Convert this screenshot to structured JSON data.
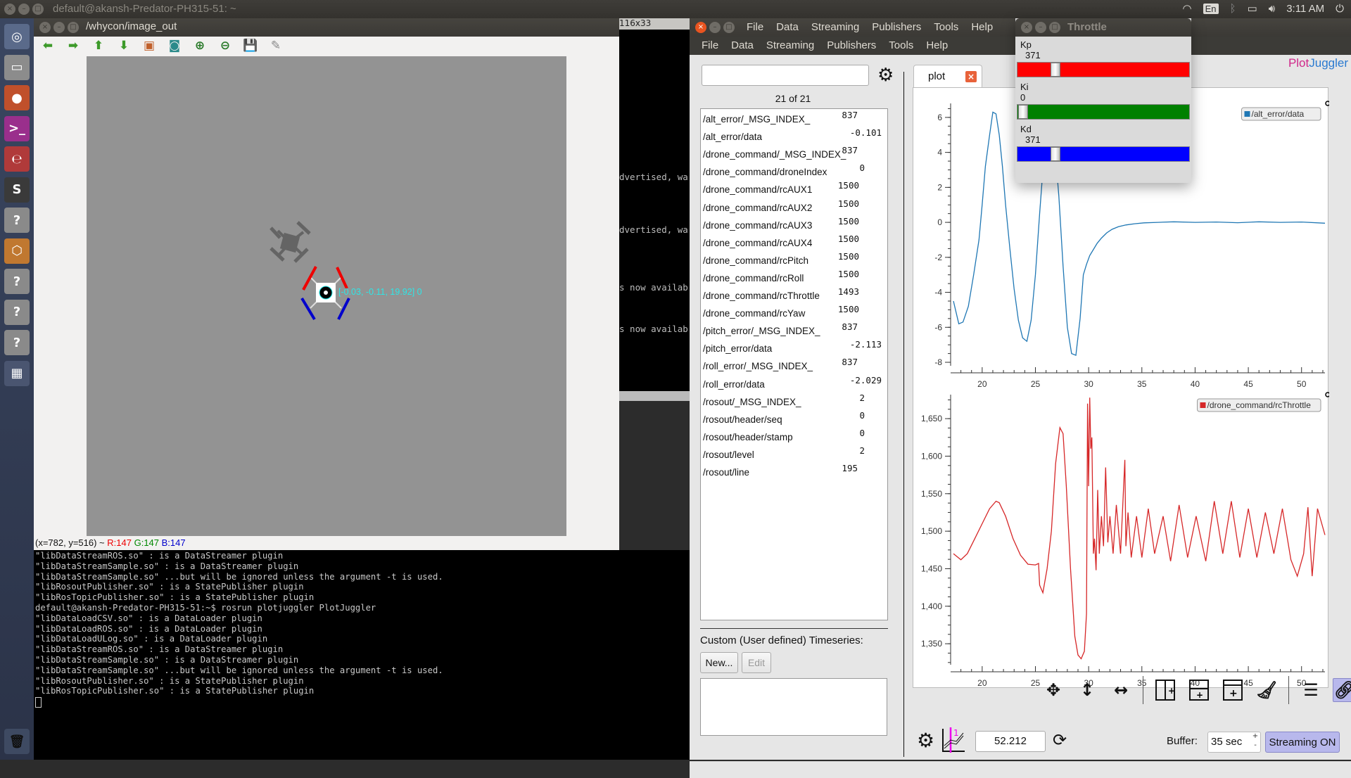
{
  "top_panel": {
    "window_title": "default@akansh-Predator-PH315-51: ~",
    "keyboard_layout": "En",
    "clock": "3:11 AM",
    "icons": [
      "wifi-icon",
      "keyboard-icon",
      "bluetooth-icon",
      "battery-icon",
      "volume-icon",
      "power-icon"
    ]
  },
  "launcher": {
    "items": [
      {
        "name": "ubuntu-dash",
        "glyph": "◎",
        "color": "#5a6a8a"
      },
      {
        "name": "files",
        "glyph": "▭",
        "color": "#8c8c8c"
      },
      {
        "name": "firefox",
        "glyph": "●",
        "color": "#c0502b"
      },
      {
        "name": "terminal",
        "glyph": ">_",
        "color": "#9a2f8c"
      },
      {
        "name": "document-viewer",
        "glyph": "℮",
        "color": "#b03a3a"
      },
      {
        "name": "sublime-text",
        "glyph": "S",
        "color": "#3a3a3a"
      },
      {
        "name": "unknown-app",
        "glyph": "?",
        "color": "#8a8a8a"
      },
      {
        "name": "virtualbox",
        "glyph": "⬡",
        "color": "#c07830"
      },
      {
        "name": "unknown-app",
        "glyph": "?",
        "color": "#8a8a8a"
      },
      {
        "name": "unknown-app",
        "glyph": "?",
        "color": "#8a8a8a"
      },
      {
        "name": "unknown-app",
        "glyph": "?",
        "color": "#8a8a8a"
      },
      {
        "name": "workspace-switcher",
        "glyph": "▦",
        "color": "#4a5570"
      }
    ],
    "trash_glyph": "🗑"
  },
  "image_viewer": {
    "title": "/whycon/image_out",
    "toolbar": [
      {
        "name": "back",
        "glyph": "⬅",
        "color": "#3d9a2a"
      },
      {
        "name": "forward",
        "glyph": "➡",
        "color": "#3d9a2a"
      },
      {
        "name": "up",
        "glyph": "⬆",
        "color": "#3d9a2a"
      },
      {
        "name": "down",
        "glyph": "⬇",
        "color": "#3d9a2a"
      },
      {
        "name": "fit-image",
        "glyph": "▣",
        "color": "#c0602b"
      },
      {
        "name": "zoom-original",
        "glyph": "◙",
        "color": "#2a8a8a"
      },
      {
        "name": "zoom-in",
        "glyph": "⊕",
        "color": "#2a7a2a"
      },
      {
        "name": "zoom-out",
        "glyph": "⊖",
        "color": "#2a7a2a"
      },
      {
        "name": "save",
        "glyph": "💾",
        "color": "#3d9a2a"
      },
      {
        "name": "clear",
        "glyph": "✎",
        "color": "#888888"
      }
    ],
    "overlay_text": "[-0.03, -0.11, 19.92] 0",
    "status": {
      "coords": "(x=782, y=516) ~ ",
      "r": "R:147",
      "g": "G:147",
      "b": "B:147"
    }
  },
  "terminal_main": {
    "lines": [
      "\"libDataStreamROS.so\" : is a DataStreamer plugin",
      "\"libDataStreamSample.so\" : is a DataStreamer plugin",
      "\"libDataStreamSample.so\" ...but will be ignored unless the argument -t is used.",
      "\"libRosoutPublisher.so\" : is a StatePublisher plugin",
      "\"libRosTopicPublisher.so\" : is a StatePublisher plugin",
      "default@akansh-Predator-PH315-51:~$ rosrun plotjuggler PlotJuggler",
      "\"libDataLoadCSV.so\" : is a DataLoader plugin",
      "\"libDataLoadROS.so\" : is a DataLoader plugin",
      "\"libDataLoadULog.so\" : is a DataLoader plugin",
      "\"libDataStreamROS.so\" : is a DataStreamer plugin",
      "\"libDataStreamSample.so\" : is a DataStreamer plugin",
      "\"libDataStreamSample.so\" ...but will be ignored unless the argument -t is used.",
      "\"libRosoutPublisher.so\" : is a StatePublisher plugin",
      "\"libRosTopicPublisher.so\" : is a StatePublisher plugin"
    ]
  },
  "terminal_side": {
    "size_label": "116x33",
    "lines": [
      "dvertised, wa",
      "dvertised, wa",
      "s now availab",
      "s now availab"
    ]
  },
  "plotjuggler": {
    "menu_top": [
      "File",
      "Data",
      "Streaming",
      "Publishers",
      "Tools",
      "Help"
    ],
    "menu": [
      "File",
      "Data",
      "Streaming",
      "Publishers",
      "Tools",
      "Help"
    ],
    "brand_a": "Plot",
    "brand_b": "Juggler",
    "search_value": "",
    "count_label": "21 of 21",
    "timeseries": [
      {
        "name": "/alt_error/_MSG_INDEX_",
        "value": "837"
      },
      {
        "name": "/alt_error/data",
        "value": "-0.101"
      },
      {
        "name": "/drone_command/_MSG_INDEX_",
        "value": "837"
      },
      {
        "name": "/drone_command/droneIndex",
        "value": "0"
      },
      {
        "name": "/drone_command/rcAUX1",
        "value": "1500"
      },
      {
        "name": "/drone_command/rcAUX2",
        "value": "1500"
      },
      {
        "name": "/drone_command/rcAUX3",
        "value": "1500"
      },
      {
        "name": "/drone_command/rcAUX4",
        "value": "1500"
      },
      {
        "name": "/drone_command/rcPitch",
        "value": "1500"
      },
      {
        "name": "/drone_command/rcRoll",
        "value": "1500"
      },
      {
        "name": "/drone_command/rcThrottle",
        "value": "1493"
      },
      {
        "name": "/drone_command/rcYaw",
        "value": "1500"
      },
      {
        "name": "/pitch_error/_MSG_INDEX_",
        "value": "837"
      },
      {
        "name": "/pitch_error/data",
        "value": "-2.113"
      },
      {
        "name": "/roll_error/_MSG_INDEX_",
        "value": "837"
      },
      {
        "name": "/roll_error/data",
        "value": "-2.029"
      },
      {
        "name": "/rosout/_MSG_INDEX_",
        "value": "2"
      },
      {
        "name": "/rosout/header/seq",
        "value": "0"
      },
      {
        "name": "/rosout/header/stamp",
        "value": "0"
      },
      {
        "name": "/rosout/level",
        "value": "2"
      },
      {
        "name": "/rosout/line",
        "value": "195"
      }
    ],
    "custom_label": "Custom (User defined) Timeseries:",
    "new_button": "New...",
    "edit_button": "Edit",
    "tab_label": "plot",
    "time_value": "52.212",
    "buffer_label": "Buffer:",
    "buffer_value": "35 sec",
    "streaming_button": "Streaming ON",
    "plot_tools": [
      "move-icon",
      "vertical-zoom-icon",
      "horizontal-zoom-icon",
      "split-vertical-icon",
      "split-horizontal-icon",
      "add-plot-icon",
      "clear-icon",
      "legend-icon",
      "link-icon"
    ]
  },
  "throttle": {
    "title": "Throttle",
    "sliders": [
      {
        "label": "Kp",
        "value": "371",
        "fraction": 0.15,
        "color": "#ff0000"
      },
      {
        "label": "Ki",
        "value": "0",
        "fraction": 0.0,
        "color": "#008000"
      },
      {
        "label": "Kd",
        "value": "371",
        "fraction": 0.15,
        "color": "#0000ff"
      }
    ]
  },
  "chart_data": [
    {
      "type": "line",
      "title": "",
      "legend": "/alt_error/data",
      "legend_position": "top-right",
      "color": "#1f77b4",
      "xlim": [
        17.3,
        52.2
      ],
      "ylim": [
        -8.2,
        6.8
      ],
      "xticks": [
        20,
        25,
        30,
        35,
        40,
        45,
        50
      ],
      "yticks": [
        -8,
        -6,
        -4,
        -2,
        0,
        2,
        4,
        6
      ],
      "x": [
        17.3,
        17.8,
        18.2,
        18.7,
        19.2,
        19.7,
        20.0,
        20.3,
        20.7,
        21.0,
        21.3,
        21.6,
        21.9,
        22.2,
        22.6,
        23.0,
        23.4,
        23.8,
        24.2,
        24.6,
        25.0,
        25.4,
        25.8,
        26.2,
        26.5,
        26.8,
        27.2,
        27.6,
        28.0,
        28.4,
        28.8,
        29.2,
        29.5,
        29.8,
        30.1,
        30.4,
        30.8,
        31.2,
        31.7,
        32.2,
        32.8,
        33.5,
        34.3,
        35.2,
        36.5,
        38.0,
        40.0,
        42.0,
        44.0,
        46.0,
        48.0,
        50.0,
        52.2
      ],
      "y": [
        -4.5,
        -5.8,
        -5.7,
        -4.8,
        -3.0,
        -1.0,
        1.0,
        3.2,
        5.0,
        6.3,
        6.2,
        5.0,
        3.2,
        1.0,
        -1.5,
        -3.8,
        -5.6,
        -6.6,
        -6.8,
        -5.6,
        -3.0,
        0.5,
        3.8,
        5.5,
        5.8,
        4.5,
        1.5,
        -2.5,
        -6.0,
        -7.5,
        -7.6,
        -5.5,
        -3.0,
        -2.4,
        -1.9,
        -1.6,
        -1.2,
        -0.9,
        -0.6,
        -0.4,
        -0.25,
        -0.15,
        -0.08,
        -0.03,
        0.0,
        0.03,
        0.0,
        0.02,
        -0.02,
        0.03,
        0.0,
        0.02,
        -0.05
      ]
    },
    {
      "type": "line",
      "title": "",
      "legend": "/drone_command/rcThrottle",
      "legend_position": "top-right",
      "color": "#d62728",
      "xlim": [
        17.3,
        52.2
      ],
      "ylim": [
        1322,
        1682
      ],
      "xticks": [
        20,
        25,
        30,
        35,
        40,
        45,
        50
      ],
      "yticks": [
        1350,
        1400,
        1450,
        1500,
        1550,
        1600,
        1650
      ],
      "ytick_labels": [
        "1,350",
        "1,400",
        "1,450",
        "1,500",
        "1,550",
        "1,600",
        "1,650"
      ],
      "x": [
        17.3,
        18.0,
        18.6,
        19.3,
        20.0,
        20.7,
        21.3,
        21.6,
        22.2,
        22.9,
        23.6,
        24.3,
        25.0,
        25.3,
        25.4,
        25.7,
        26.1,
        26.5,
        26.9,
        27.3,
        27.6,
        27.9,
        28.3,
        28.7,
        29.0,
        29.3,
        29.6,
        29.8,
        29.9,
        30.0,
        30.1,
        30.2,
        30.3,
        30.45,
        30.55,
        30.7,
        30.85,
        31.0,
        31.2,
        31.4,
        31.6,
        31.8,
        32.0,
        32.3,
        32.6,
        33.0,
        33.4,
        33.5,
        33.7,
        34.0,
        34.5,
        35.0,
        35.6,
        36.2,
        37.0,
        37.7,
        38.5,
        39.3,
        40.1,
        41.0,
        41.8,
        42.6,
        43.4,
        44.2,
        45.0,
        45.8,
        46.6,
        47.4,
        48.2,
        49.0,
        49.6,
        50.2,
        50.6,
        51.0,
        51.5,
        52.2
      ],
      "y": [
        1470,
        1462,
        1470,
        1490,
        1510,
        1530,
        1540,
        1538,
        1520,
        1490,
        1468,
        1456,
        1455,
        1457,
        1428,
        1418,
        1450,
        1500,
        1590,
        1638,
        1630,
        1560,
        1450,
        1360,
        1335,
        1330,
        1340,
        1390,
        1670,
        1560,
        1678,
        1610,
        1625,
        1470,
        1490,
        1448,
        1555,
        1470,
        1520,
        1480,
        1585,
        1485,
        1520,
        1470,
        1535,
        1470,
        1595,
        1480,
        1525,
        1465,
        1520,
        1465,
        1530,
        1470,
        1520,
        1460,
        1535,
        1465,
        1520,
        1460,
        1540,
        1470,
        1540,
        1465,
        1530,
        1465,
        1525,
        1470,
        1530,
        1462,
        1440,
        1470,
        1532,
        1440,
        1530,
        1495
      ]
    }
  ]
}
